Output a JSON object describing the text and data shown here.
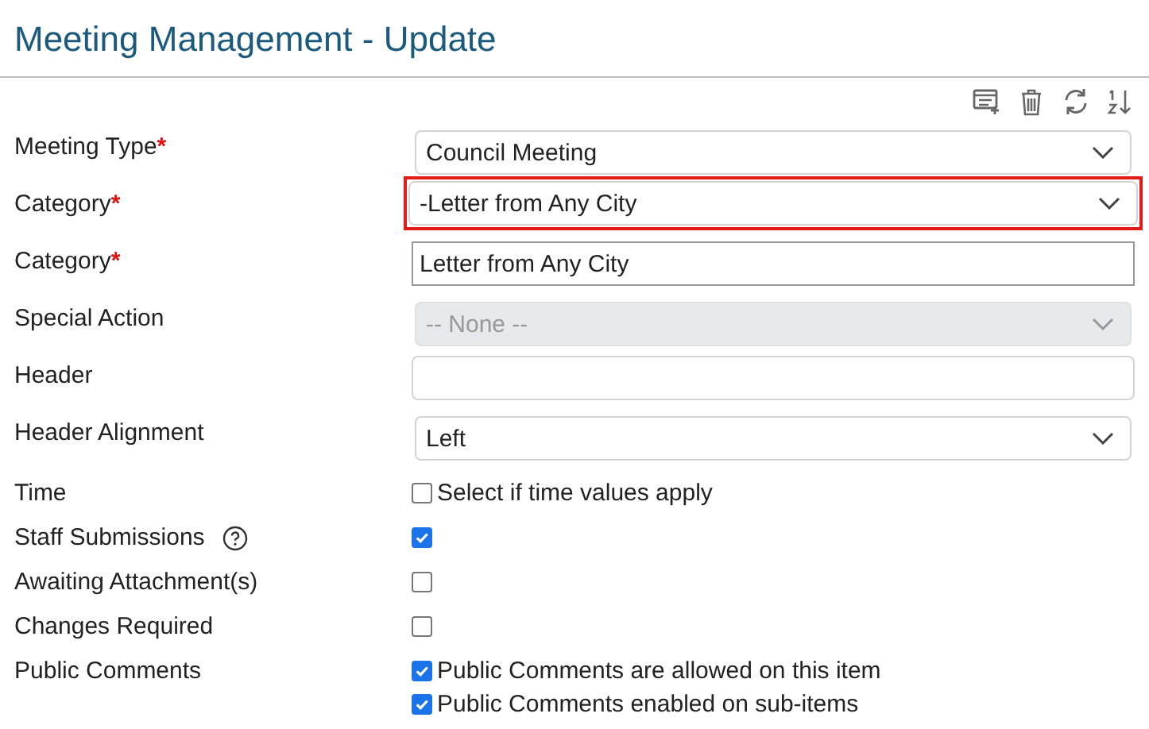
{
  "page_title": "Meeting Management - Update",
  "toolbar": [
    {
      "kind": "add-list"
    },
    {
      "kind": "delete"
    },
    {
      "kind": "refresh"
    },
    {
      "kind": "sort"
    }
  ],
  "fields": [
    {
      "kind": "select",
      "label": "Meeting Type",
      "required_mark": "*",
      "value": "Council Meeting",
      "highlighted": false,
      "disabled": false
    },
    {
      "kind": "select",
      "label": "Category",
      "required_mark": "*",
      "value": "-Letter from Any City",
      "highlighted": true,
      "disabled": false
    },
    {
      "kind": "text",
      "label": "Category",
      "required_mark": "*",
      "value": "Letter from Any City",
      "boxed": true
    },
    {
      "kind": "select",
      "label": "Special Action",
      "value": "-- None --",
      "highlighted": false,
      "disabled": true
    },
    {
      "kind": "text",
      "label": "Header",
      "boxed": false
    },
    {
      "kind": "select",
      "label": "Header Alignment",
      "value": "Left",
      "highlighted": false,
      "disabled": false
    },
    {
      "kind": "checks",
      "label": "Time",
      "options": [
        {
          "text": "Select if time values apply",
          "checked": false
        }
      ]
    },
    {
      "kind": "checks",
      "label": "Staff Submissions",
      "help": true,
      "options": [
        {
          "checked": true
        }
      ]
    },
    {
      "kind": "checks",
      "label": "Awaiting Attachment(s)",
      "options": [
        {
          "checked": false
        }
      ]
    },
    {
      "kind": "checks",
      "label": "Changes Required",
      "options": [
        {
          "checked": false
        }
      ]
    },
    {
      "kind": "checks",
      "label": "Public Comments",
      "options": [
        {
          "text": "Public Comments are allowed on this item",
          "checked": true
        },
        {
          "text": "Public Comments enabled on sub-items",
          "checked": true
        }
      ]
    }
  ]
}
